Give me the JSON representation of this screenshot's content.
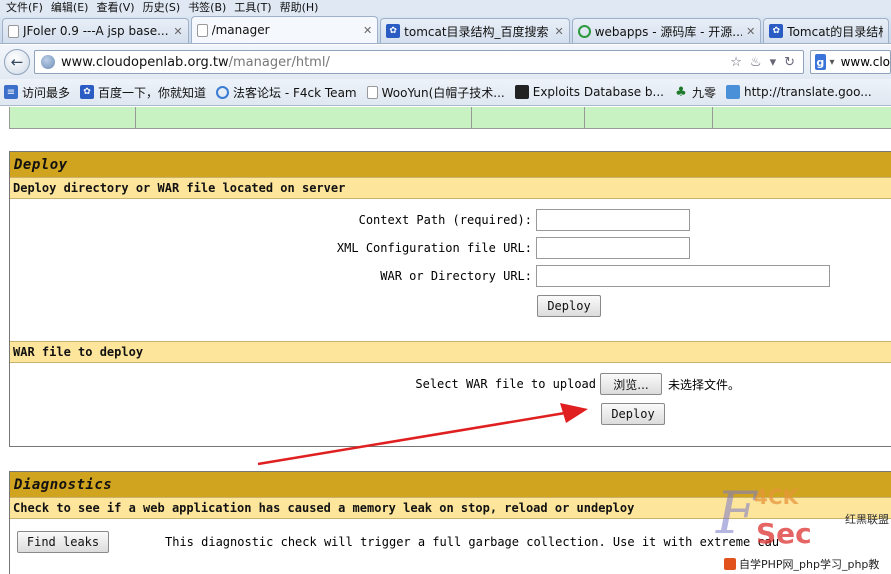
{
  "menu": [
    "文件(F)",
    "编辑(E)",
    "查看(V)",
    "历史(S)",
    "书签(B)",
    "工具(T)",
    "帮助(H)"
  ],
  "tabs": [
    {
      "label": "JFoler 0.9 ---A jsp base...",
      "icon": "page-icon",
      "active": false
    },
    {
      "label": "/manager",
      "icon": "page-icon",
      "active": true
    },
    {
      "label": "tomcat目录结构_百度搜索",
      "icon": "baidu-paw-icon",
      "active": false
    },
    {
      "label": "webapps - 源码库 - 开源...",
      "icon": "source-icon",
      "active": false
    },
    {
      "label": "Tomcat的目录结构",
      "icon": "baidu-paw-icon",
      "active": false
    }
  ],
  "url": {
    "host": "www.cloudopenlab.org.tw",
    "path": "/manager/html/"
  },
  "search": {
    "value": "www.clo"
  },
  "bookmarks": [
    {
      "label": "访问最多",
      "icon": "bookmark-icon"
    },
    {
      "label": "百度一下，你就知道",
      "icon": "baidu-paw-icon"
    },
    {
      "label": "法客论坛 - F4ck Team",
      "icon": "forum-icon"
    },
    {
      "label": "WooYun(白帽子技术...",
      "icon": "page-icon"
    },
    {
      "label": "Exploits Database b...",
      "icon": "exploit-db-icon"
    },
    {
      "label": "九零",
      "icon": "leaf-icon"
    },
    {
      "label": "http://translate.goo...",
      "icon": "translate-icon"
    }
  ],
  "deploy": {
    "title": "Deploy",
    "server_subtitle": "Deploy directory or WAR file located on server",
    "context_path_label": "Context Path (required):",
    "context_path_value": "",
    "xml_config_label": "XML Configuration file URL:",
    "xml_config_value": "",
    "war_dir_label": "WAR or Directory URL:",
    "war_dir_value": "",
    "deploy_button": "Deploy",
    "war_subtitle": "WAR file to deploy",
    "select_war_label": "Select WAR file to upload",
    "browse_button": "浏览...",
    "no_file_text": "未选择文件。",
    "war_deploy_button": "Deploy"
  },
  "diagnostics": {
    "title": "Diagnostics",
    "subtitle": "Check to see if a web application has caused a memory leak on stop, reload or undeploy",
    "find_leaks_button": "Find leaks",
    "description": "This diagnostic check will trigger a full garbage collection. Use it with extreme cau"
  },
  "watermark": {
    "brand_letter": "F",
    "brand_4ck": "4CK",
    "brand_sec": "Sec",
    "union": "红黑联盟",
    "footer": "自学PHP网_php学习_php教"
  },
  "colors": {
    "section_title_bg": "#d1a41f",
    "section_sub_bg": "#fde59c",
    "table_row_bg": "#c8f2c2",
    "arrow": "#e02020"
  }
}
